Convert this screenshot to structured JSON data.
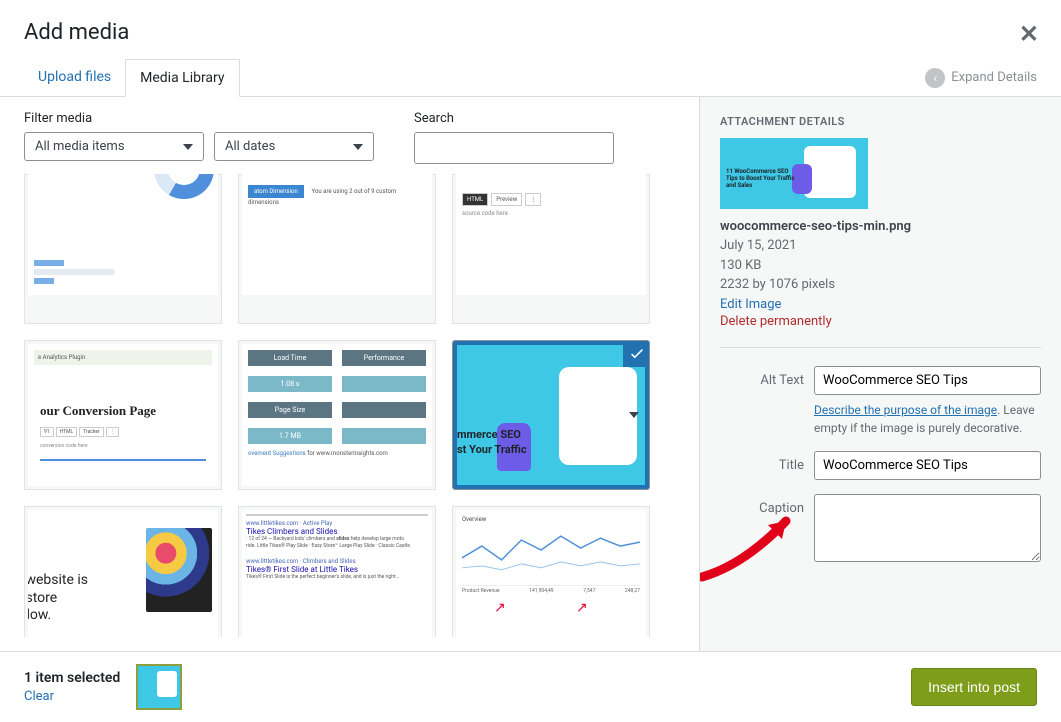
{
  "header": {
    "title": "Add media"
  },
  "tabs": {
    "upload": "Upload files",
    "library": "Media Library"
  },
  "expand": "Expand Details",
  "filter": {
    "label": "Filter media",
    "media_items": "All media items",
    "dates": "All dates"
  },
  "search": {
    "label": "Search"
  },
  "thumbs": {
    "woo_line1": "mmerce SEO",
    "woo_line2": "st Your Traffic",
    "conv_title": "our Conversion Page",
    "metrics": {
      "lt": "Load Time",
      "pf": "Performance",
      "v1": "1.08 s",
      "ps": "Page Size",
      "v2": "1.7 MB"
    },
    "suggestion": "for www.monsterinsights.com",
    "website_txt": "website is\nstore\ndow.",
    "serp": {
      "l1": "www.littletikes.com · Active Play",
      "l2": "Tikes Climbers and Slides",
      "l3": "www.littletikes.com · Climbers and Slides",
      "l4": "Tikes® First Slide at Little Tikes"
    },
    "chart_nums": {
      "a": "141,904,49",
      "b": "7,547",
      "c": "248,27"
    }
  },
  "details": {
    "heading": "ATTACHMENT DETAILS",
    "filename": "woocommerce-seo-tips-min.png",
    "date": "July 15, 2021",
    "size": "130 KB",
    "dimensions": "2232 by 1076 pixels",
    "edit": "Edit Image",
    "delete": "Delete permanently",
    "preview_line1": "11 WooCommerce SEO",
    "preview_line2": "Tips to Boost Your Traffic",
    "preview_line3": "and Sales",
    "alt_label": "Alt Text",
    "alt_value": "WooCommerce SEO Tips",
    "alt_help_link": "Describe the purpose of the image",
    "alt_help_rest": ". Leave empty if the image is purely decorative.",
    "title_label": "Title",
    "title_value": "WooCommerce SEO Tips",
    "caption_label": "Caption"
  },
  "footer": {
    "selected": "1 item selected",
    "clear": "Clear",
    "insert": "Insert into post"
  }
}
